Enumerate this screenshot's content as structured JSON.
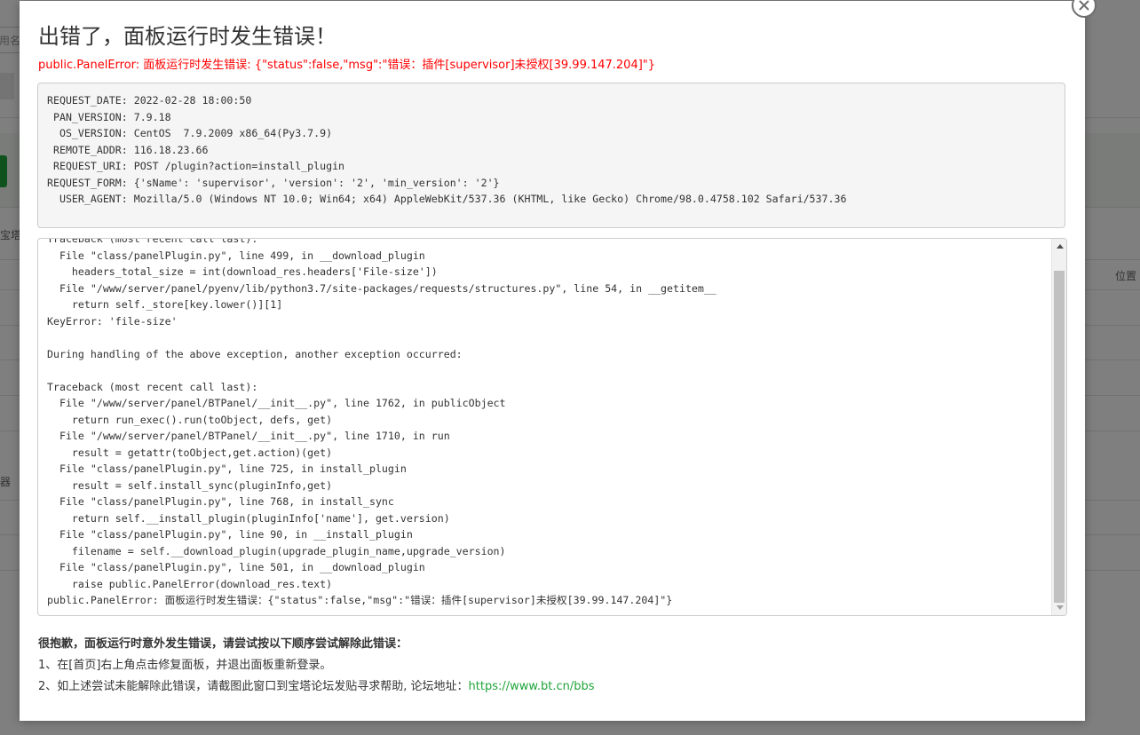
{
  "background": {
    "search_placeholder": "用名称",
    "side_text_1": "宝塔",
    "side_text_2": "器",
    "column_header": "位置"
  },
  "modal": {
    "close_icon": "close-icon",
    "title": "出错了，面板运行时发生错误！",
    "error_message": "public.PanelError: 面板运行时发生错误: {\"status\":false,\"msg\":\"错误：插件[supervisor]未授权[39.99.147.204]\"}",
    "info_lines": [
      "REQUEST_DATE: 2022-02-28 18:00:50",
      " PAN_VERSION: 7.9.18",
      "  OS_VERSION: CentOS  7.9.2009 x86_64(Py3.7.9)",
      " REMOTE_ADDR: 116.18.23.66",
      " REQUEST_URI: POST /plugin?action=install_plugin",
      "REQUEST_FORM: {'sName': 'supervisor', 'version': '2', 'min_version': '2'}",
      "  USER_AGENT: Mozilla/5.0 (Windows NT 10.0; Win64; x64) AppleWebKit/537.36 (KHTML, like Gecko) Chrome/98.0.4758.102 Safari/537.36"
    ],
    "trace_lines": [
      "Traceback (most recent call last):",
      "  File \"class/panelPlugin.py\", line 499, in __download_plugin",
      "    headers_total_size = int(download_res.headers['File-size'])",
      "  File \"/www/server/panel/pyenv/lib/python3.7/site-packages/requests/structures.py\", line 54, in __getitem__",
      "    return self._store[key.lower()][1]",
      "KeyError: 'file-size'",
      "",
      "During handling of the above exception, another exception occurred:",
      "",
      "Traceback (most recent call last):",
      "  File \"/www/server/panel/BTPanel/__init__.py\", line 1762, in publicObject",
      "    return run_exec().run(toObject, defs, get)",
      "  File \"/www/server/panel/BTPanel/__init__.py\", line 1710, in run",
      "    result = getattr(toObject,get.action)(get)",
      "  File \"class/panelPlugin.py\", line 725, in install_plugin",
      "    result = self.install_sync(pluginInfo,get)",
      "  File \"class/panelPlugin.py\", line 768, in install_sync",
      "    return self.__install_plugin(pluginInfo['name'], get.version)",
      "  File \"class/panelPlugin.py\", line 90, in __install_plugin",
      "    filename = self.__download_plugin(upgrade_plugin_name,upgrade_version)",
      "  File \"class/panelPlugin.py\", line 501, in __download_plugin",
      "    raise public.PanelError(download_res.text)",
      "public.PanelError: 面板运行时发生错误：{\"status\":false,\"msg\":\"错误：插件[supervisor]未授权[39.99.147.204]\"}"
    ],
    "help_title": "很抱歉，面板运行时意外发生错误，请尝试按以下顺序尝试解除此错误：",
    "help_line_1": "1、在[首页]右上角点击修复面板，并退出面板重新登录。",
    "help_line_2_prefix": "2、如上述尝试未能解除此错误，请截图此窗口到宝塔论坛发贴寻求帮助, 论坛地址：",
    "forum_link": "https://www.bt.cn/bbs"
  },
  "colors": {
    "error_red": "#ff0000",
    "link_green": "#20a53a",
    "overlay": "rgba(0,0,0,0.5)"
  }
}
